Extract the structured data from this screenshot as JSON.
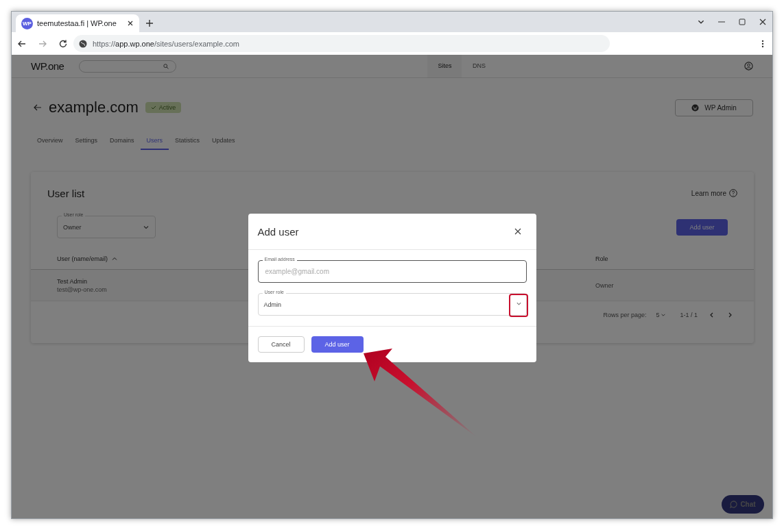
{
  "browser": {
    "tab_title": "teemutestaa.fi | WP.one",
    "favicon": "WP",
    "url_scheme": "https://",
    "url_host": "app.wp.one",
    "url_path": "/sites/users/example.com"
  },
  "header": {
    "logo": "WP.one",
    "nav": [
      {
        "label": "Sites",
        "selected": true
      },
      {
        "label": "DNS",
        "selected": false
      }
    ]
  },
  "site": {
    "title": "example.com",
    "status": "Active",
    "wp_admin": "WP Admin"
  },
  "tabs": [
    {
      "label": "Overview",
      "selected": false
    },
    {
      "label": "Settings",
      "selected": false
    },
    {
      "label": "Domains",
      "selected": false
    },
    {
      "label": "Users",
      "selected": true
    },
    {
      "label": "Statistics",
      "selected": false
    },
    {
      "label": "Updates",
      "selected": false
    }
  ],
  "user_list": {
    "title": "User list",
    "learn_more": "Learn more",
    "filter": {
      "label": "User role",
      "value": "Owner"
    },
    "add_button": "Add user",
    "columns": [
      "User (name/email)",
      "Role"
    ],
    "rows": [
      {
        "name": "Test Admin",
        "email": "test@wp-one.com",
        "role": "Owner"
      }
    ],
    "pagination": {
      "rows_label": "Rows per page:",
      "rows_value": "5",
      "range": "1-1 / 1"
    }
  },
  "dialog": {
    "title": "Add user",
    "fields": [
      {
        "kind": "text",
        "label": "Email address",
        "placeholder": "example@gmail.com",
        "focused": true
      },
      {
        "kind": "select",
        "label": "User role",
        "value": "Admin",
        "focused": false,
        "highlighted": true
      }
    ],
    "buttons": [
      {
        "label": "Cancel",
        "primary": false
      },
      {
        "label": "Add user",
        "primary": true
      }
    ]
  },
  "chat": {
    "label": "Chat"
  }
}
